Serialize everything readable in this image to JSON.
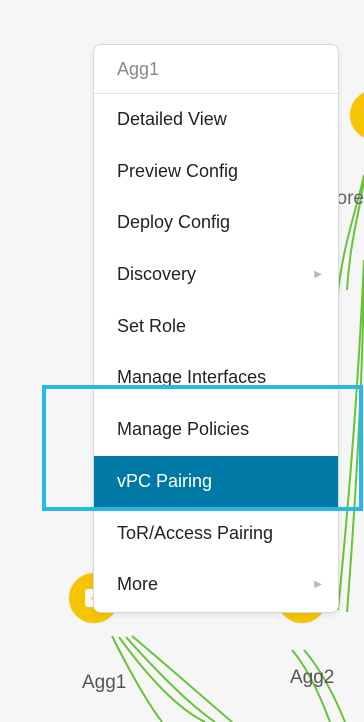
{
  "menu": {
    "header": "Agg1",
    "items": [
      {
        "label": "Detailed View",
        "has_submenu": false,
        "selected": false
      },
      {
        "label": "Preview Config",
        "has_submenu": false,
        "selected": false
      },
      {
        "label": "Deploy Config",
        "has_submenu": false,
        "selected": false
      },
      {
        "label": "Discovery",
        "has_submenu": true,
        "selected": false
      },
      {
        "label": "Set Role",
        "has_submenu": false,
        "selected": false
      },
      {
        "label": "Manage Interfaces",
        "has_submenu": false,
        "selected": false
      },
      {
        "label": "Manage Policies",
        "has_submenu": false,
        "selected": false
      },
      {
        "label": "vPC Pairing",
        "has_submenu": false,
        "selected": true
      },
      {
        "label": "ToR/Access Pairing",
        "has_submenu": false,
        "selected": false
      },
      {
        "label": "More",
        "has_submenu": true,
        "selected": false
      }
    ]
  },
  "nodes": {
    "agg1_label": "Agg1",
    "agg2_label": "Agg2",
    "partial_label": "ore"
  },
  "colors": {
    "node": "#f6c400",
    "link": "#68c33a",
    "selection": "#007aa4",
    "highlight": "#24b9e8"
  },
  "icons": {
    "arrow": "▶",
    "swap": "↔"
  }
}
